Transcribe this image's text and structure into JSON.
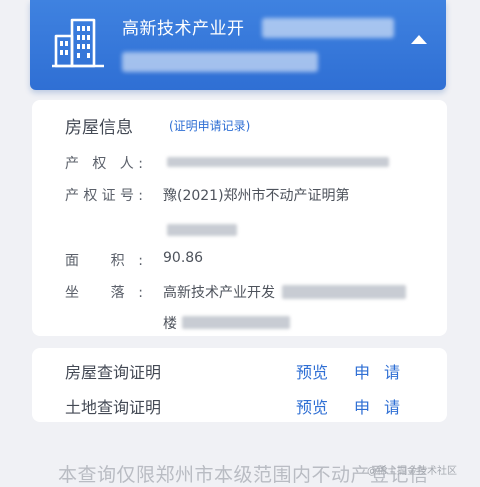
{
  "header": {
    "title": "高新技术产业开"
  },
  "info_card": {
    "section_title": "房屋信息",
    "record_link": "(证明申请记录)",
    "fields": [
      {
        "label": "产 权 人:",
        "value": ""
      },
      {
        "label": "产权证号:",
        "value": "豫(2021)郑州市不动产证明第"
      },
      {
        "label": "面    积:",
        "value": "90.86"
      },
      {
        "label": "坐    落:",
        "value": "高新技术产业开发"
      }
    ],
    "location_line2": "楼"
  },
  "cert_card": {
    "rows": [
      {
        "label": "房屋查询证明",
        "preview": "预览",
        "apply": "申请"
      },
      {
        "label": "土地查询证明",
        "preview": "预览",
        "apply": "申请"
      }
    ]
  },
  "footer_note": "本查询仅限郑州市本级范围内不动产登记信",
  "watermark": "@稀土掘金技术社区"
}
